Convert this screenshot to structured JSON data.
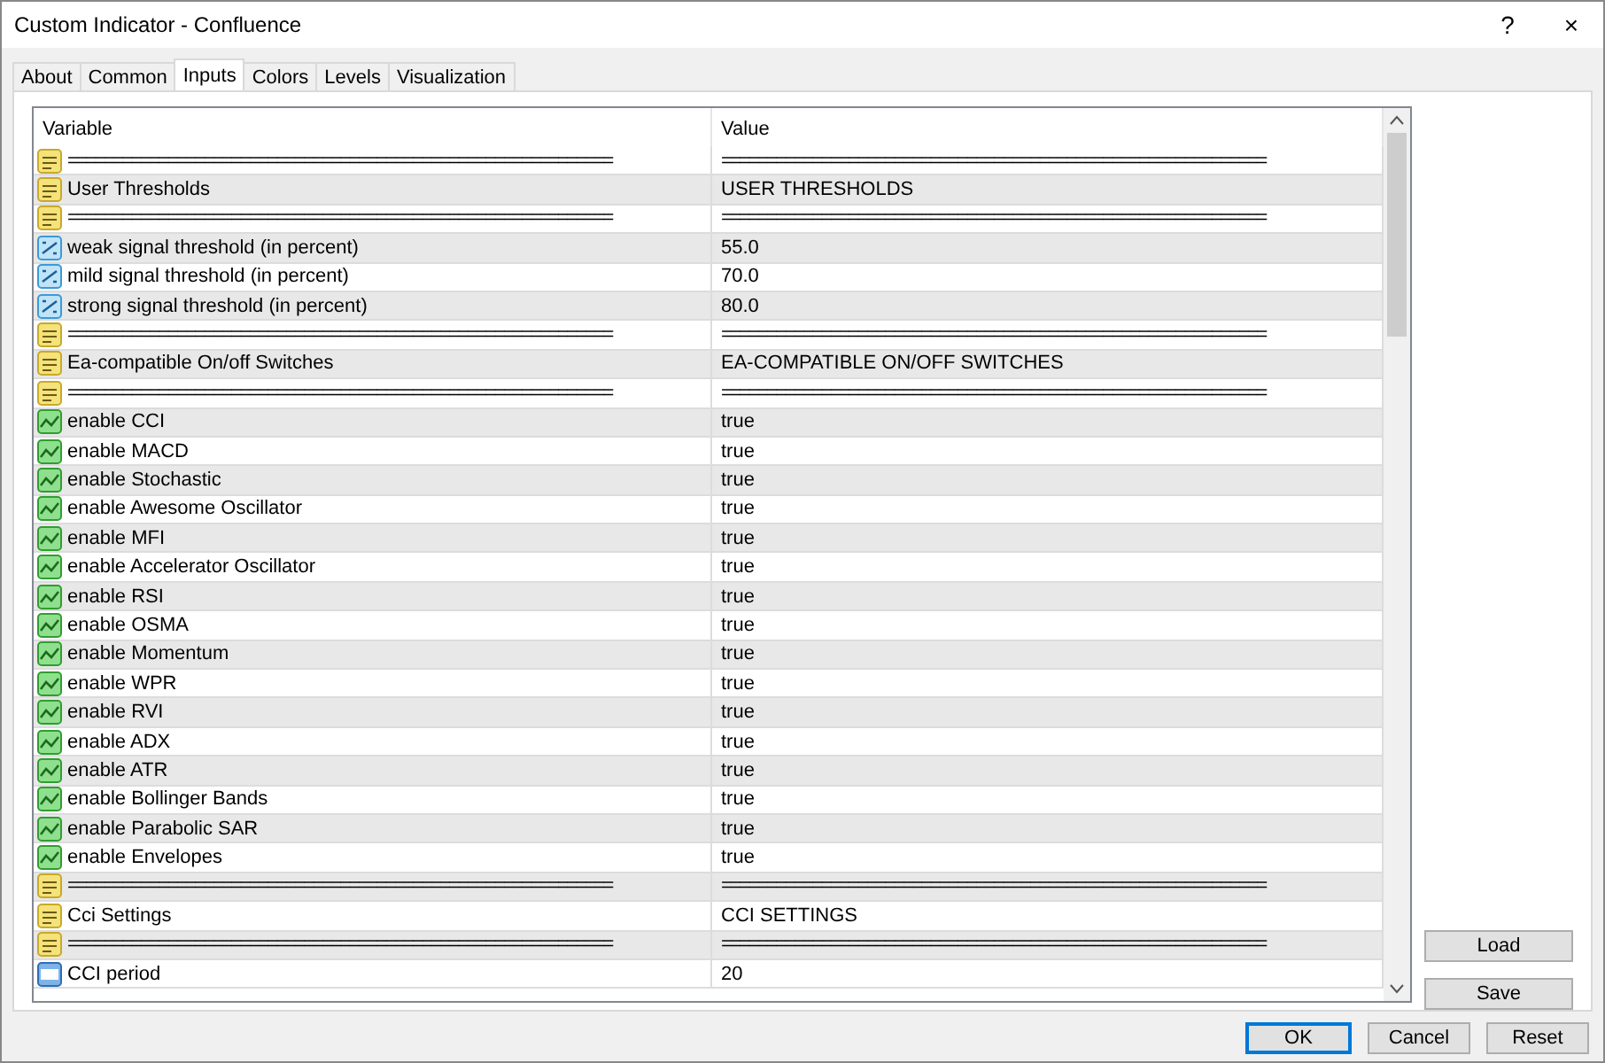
{
  "window": {
    "title": "Custom Indicator - Confluence",
    "help": "?",
    "close": "×"
  },
  "tabs": [
    {
      "label": "About",
      "selected": false
    },
    {
      "label": "Common",
      "selected": false
    },
    {
      "label": "Inputs",
      "selected": true
    },
    {
      "label": "Colors",
      "selected": false
    },
    {
      "label": "Levels",
      "selected": false
    },
    {
      "label": "Visualization",
      "selected": false
    }
  ],
  "table": {
    "columns": [
      "Variable",
      "Value"
    ],
    "rows": [
      {
        "kind": "separator",
        "variable": "============================================================",
        "value": "============================================================"
      },
      {
        "kind": "string",
        "variable": "User Thresholds",
        "value": "USER THRESHOLDS"
      },
      {
        "kind": "separator",
        "variable": "============================================================",
        "value": "============================================================"
      },
      {
        "kind": "double",
        "variable": "weak signal threshold (in percent)",
        "value": "55.0"
      },
      {
        "kind": "double",
        "variable": "mild signal threshold (in percent)",
        "value": "70.0"
      },
      {
        "kind": "double",
        "variable": "strong signal threshold (in percent)",
        "value": "80.0"
      },
      {
        "kind": "separator",
        "variable": "============================================================",
        "value": "============================================================"
      },
      {
        "kind": "string",
        "variable": "Ea-compatible On/off Switches",
        "value": "EA-COMPATIBLE ON/OFF SWITCHES"
      },
      {
        "kind": "separator",
        "variable": "============================================================",
        "value": "============================================================"
      },
      {
        "kind": "bool",
        "variable": "enable CCI",
        "value": "true"
      },
      {
        "kind": "bool",
        "variable": "enable MACD",
        "value": "true"
      },
      {
        "kind": "bool",
        "variable": "enable Stochastic",
        "value": "true"
      },
      {
        "kind": "bool",
        "variable": "enable Awesome Oscillator",
        "value": "true"
      },
      {
        "kind": "bool",
        "variable": "enable MFI",
        "value": "true"
      },
      {
        "kind": "bool",
        "variable": "enable Accelerator Oscillator",
        "value": "true"
      },
      {
        "kind": "bool",
        "variable": "enable RSI",
        "value": "true"
      },
      {
        "kind": "bool",
        "variable": "enable OSMA",
        "value": "true"
      },
      {
        "kind": "bool",
        "variable": "enable Momentum",
        "value": "true"
      },
      {
        "kind": "bool",
        "variable": "enable WPR",
        "value": "true"
      },
      {
        "kind": "bool",
        "variable": "enable RVI",
        "value": "true"
      },
      {
        "kind": "bool",
        "variable": "enable ADX",
        "value": "true"
      },
      {
        "kind": "bool",
        "variable": "enable ATR",
        "value": "true"
      },
      {
        "kind": "bool",
        "variable": "enable Bollinger Bands",
        "value": "true"
      },
      {
        "kind": "bool",
        "variable": "enable Parabolic SAR",
        "value": "true"
      },
      {
        "kind": "bool",
        "variable": "enable Envelopes",
        "value": "true"
      },
      {
        "kind": "separator",
        "variable": "============================================================",
        "value": "============================================================"
      },
      {
        "kind": "string",
        "variable": "Cci Settings",
        "value": "CCI SETTINGS"
      },
      {
        "kind": "separator",
        "variable": "============================================================",
        "value": "============================================================"
      },
      {
        "kind": "int",
        "variable": "CCI period",
        "value": "20"
      }
    ]
  },
  "side_buttons": [
    "Load",
    "Save"
  ],
  "buttons": [
    {
      "label": "OK",
      "selected": true
    },
    {
      "label": "Cancel",
      "selected": false
    },
    {
      "label": "Reset",
      "selected": false
    }
  ]
}
